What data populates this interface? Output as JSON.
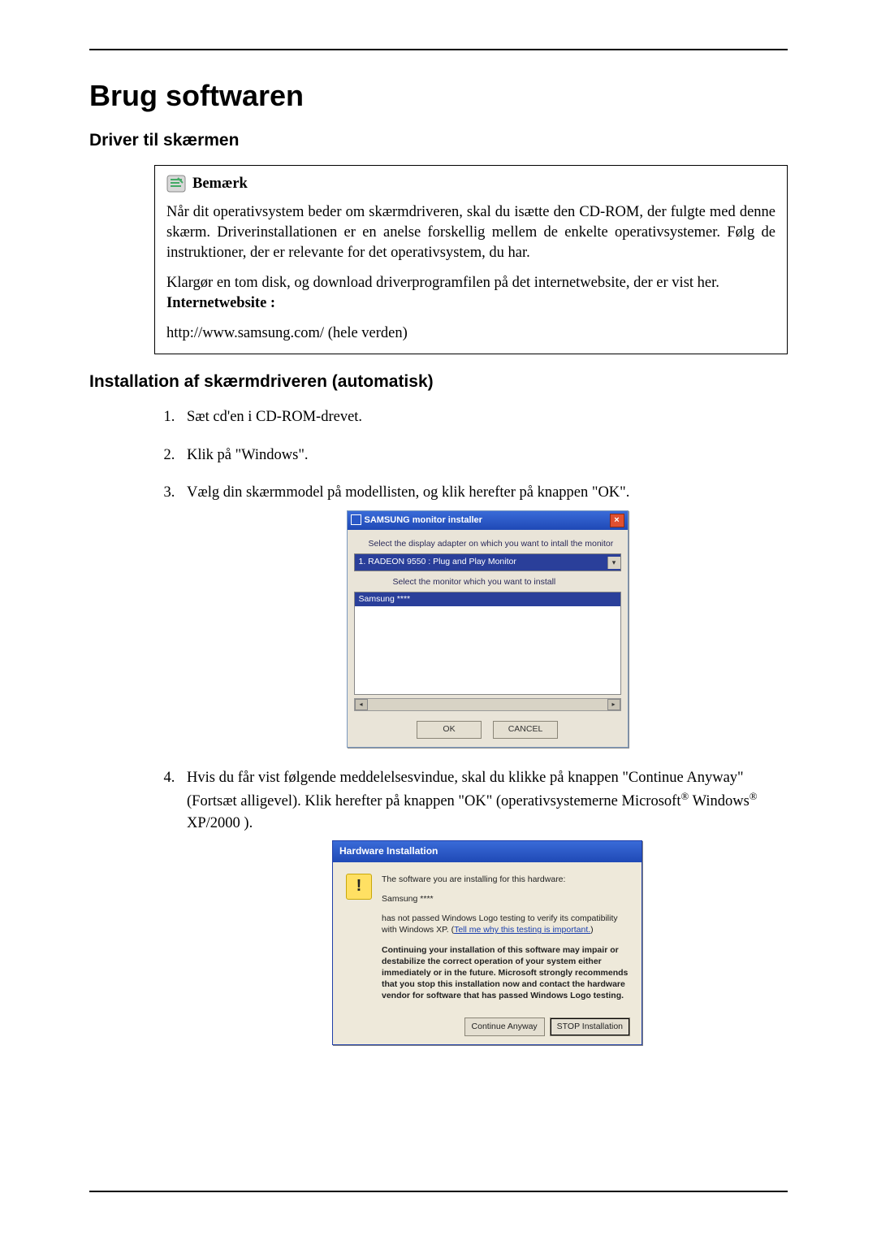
{
  "heading": "Brug softwaren",
  "sub1": "Driver til skærmen",
  "note": {
    "title": "Bemærk",
    "p1": "Når dit operativsystem beder om skærmdriveren, skal du isætte den CD-ROM, der fulgte med denne skærm. Driverinstallationen er en anelse forskellig mellem de enkelte operativsystemer. Følg de instruktioner, der er relevante for det operativsystem, du har.",
    "p2a": "Klargør en tom disk, og download driverprogramfilen på det internetwebsite, der er vist her.",
    "site_label": "Internetwebsite :",
    "url": "http://www.samsung.com/ (hele verden)"
  },
  "sub2": "Installation af skærmdriveren (automatisk)",
  "steps": {
    "s1": "Sæt cd'en i CD-ROM-drevet.",
    "s2": "Klik på \"Windows\".",
    "s3": "Vælg din skærmmodel på modellisten, og klik herefter på knappen \"OK\".",
    "s4a": "Hvis du får vist følgende meddelelsesvindue, skal du klikke på knappen \"Continue Anyway\" (Fortsæt alligevel). Klik herefter på knappen \"OK\" (operativsystemerne Microsoft",
    "s4b": " Windows",
    "s4c": " XP/2000 )."
  },
  "dlg1": {
    "title": "SAMSUNG monitor installer",
    "lbl1": "Select the display adapter on which you want to intall the monitor",
    "combo": "1. RADEON 9550 : Plug and Play Monitor",
    "lbl2": "Select the monitor which you want to install",
    "sel": "Samsung ****",
    "ok": "OK",
    "cancel": "CANCEL"
  },
  "dlg2": {
    "title": "Hardware Installation",
    "p1": "The software you are installing for this hardware:",
    "dev": "Samsung ****",
    "p2a": "has not passed Windows Logo testing to verify its compatibility with Windows XP. (",
    "link": "Tell me why this testing is important.",
    "p2b": ")",
    "warn": "Continuing your installation of this software may impair or destabilize the correct operation of your system either immediately or in the future. Microsoft strongly recommends that you stop this installation now and contact the hardware vendor for software that has passed Windows Logo testing.",
    "btn1": "Continue Anyway",
    "btn2": "STOP Installation"
  },
  "reg": "®"
}
